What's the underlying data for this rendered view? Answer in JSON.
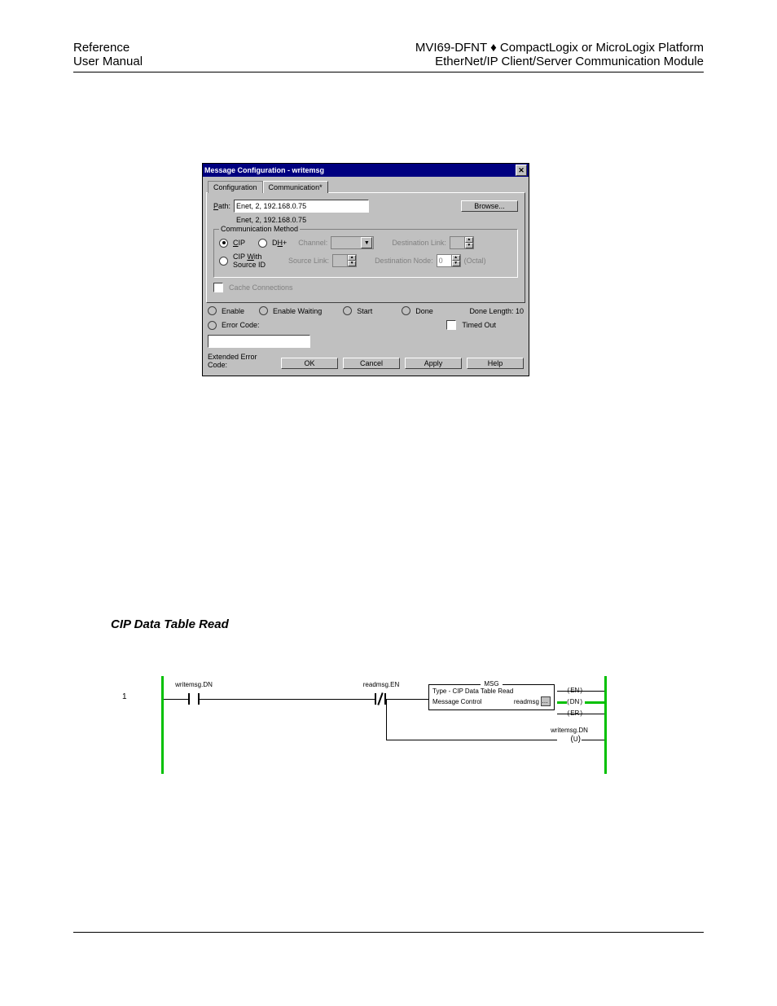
{
  "header": {
    "left_line1": "Reference",
    "left_line2": "User Manual",
    "right_line1_pre": "MVI69-DFNT ",
    "right_line1_post": " CompactLogix or MicroLogix Platform",
    "right_line2": "EtherNet/IP Client/Server Communication Module"
  },
  "dialog": {
    "title": "Message Configuration - writemsg",
    "tabs": {
      "config": "Configuration",
      "comm": "Communication*"
    },
    "path_label": "Path:",
    "path_value": "Enet, 2, 192.168.0.75",
    "path_echo": "Enet, 2, 192.168.0.75",
    "browse": "Browse...",
    "comm_method": {
      "group": "Communication Method",
      "cip": "CIP",
      "dhplus": "DH+",
      "channel": "Channel:",
      "dest_link": "Destination Link:",
      "cip_with_src": "CIP With\nSource ID",
      "src_link": "Source Link:",
      "dest_node": "Destination Node:",
      "zero": "0",
      "octal": "(Octal)"
    },
    "cache": "Cache Connections",
    "status": {
      "enable": "Enable",
      "enable_waiting": "Enable Waiting",
      "start": "Start",
      "done": "Done",
      "done_length": "Done Length: 10",
      "error_code": "Error Code:",
      "timed_out": "Timed Out",
      "ext_error": "Extended Error Code:"
    },
    "buttons": {
      "ok": "OK",
      "cancel": "Cancel",
      "apply": "Apply",
      "help": "Help"
    }
  },
  "section_heading": "CIP Data Table Read",
  "ladder": {
    "rung": "1",
    "xic_label": "writemsg.DN",
    "xio_label": "readmsg.EN",
    "msg": {
      "title": "MSG",
      "type_line": "Type - CIP Data Table Read",
      "ctrl_label": "Message Control",
      "ctrl_value": "readmsg"
    },
    "outs": {
      "en": "EN",
      "dn": "DN",
      "er": "ER"
    },
    "coil_label": "writemsg.DN",
    "coil_sym": "U"
  }
}
